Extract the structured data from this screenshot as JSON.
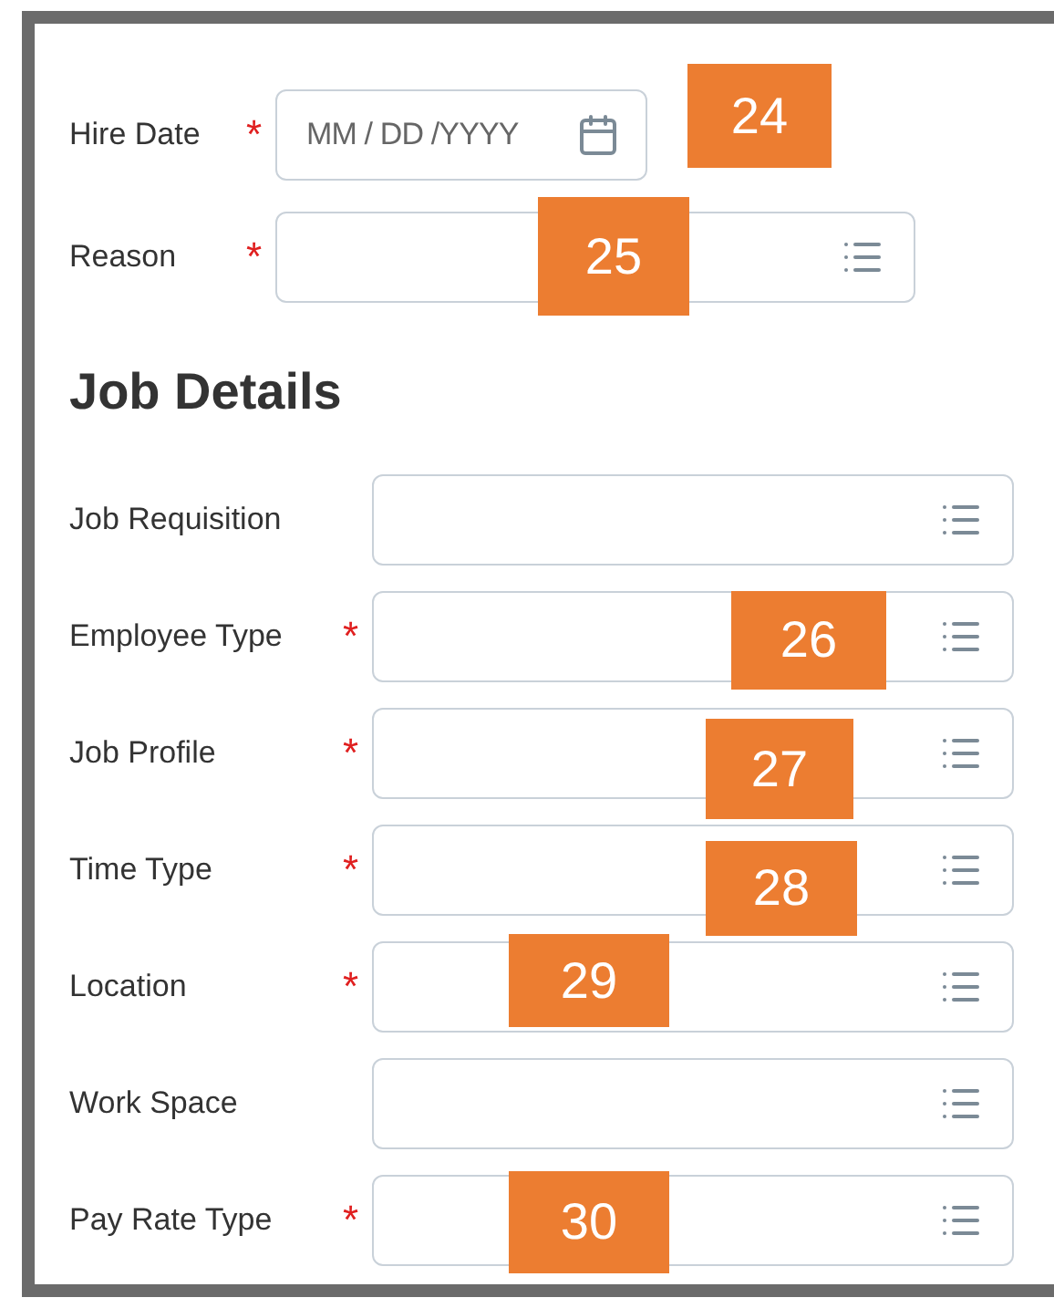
{
  "sections": [
    {
      "fields": [
        {
          "label": "Hire Date",
          "required_mark": "*",
          "kind": "date",
          "placeholder": "MM / DD /YYYY",
          "annotation": "24"
        },
        {
          "label": "Reason",
          "required_mark": "*",
          "kind": "select",
          "annotation": "25"
        }
      ]
    },
    {
      "heading": "Job Details",
      "fields": [
        {
          "label": "Job Requisition",
          "kind": "select"
        },
        {
          "label": "Employee Type",
          "required_mark": "*",
          "kind": "select",
          "annotation": "26"
        },
        {
          "label": "Job Profile",
          "required_mark": "*",
          "kind": "select",
          "annotation": "27"
        },
        {
          "label": "Time Type",
          "required_mark": "*",
          "kind": "select",
          "annotation": "28"
        },
        {
          "label": "Location",
          "required_mark": "*",
          "kind": "select",
          "annotation": "29"
        },
        {
          "label": "Work Space",
          "kind": "select"
        },
        {
          "label": "Pay Rate Type",
          "required_mark": "*",
          "kind": "select",
          "annotation": "30"
        }
      ]
    }
  ]
}
